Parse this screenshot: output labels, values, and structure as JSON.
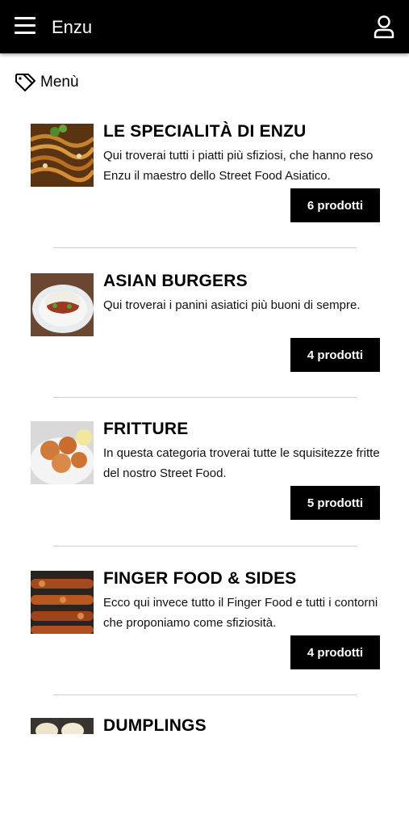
{
  "header": {
    "title": "Enzu",
    "menu_icon": "hamburger-menu-icon",
    "user_icon": "user-icon"
  },
  "section": {
    "icon": "tag-icon",
    "title": "Menù"
  },
  "categories": [
    {
      "title": "LE SPECIALITÀ DI ENZU",
      "description": "Qui troverai tutti i piatti più sfiziosi, che hanno reso Enzu il maestro dello Street Food Asiatico.",
      "count_label": "6 prodotti"
    },
    {
      "title": "ASIAN BURGERS",
      "description": "Qui troverai i panini asiatici più buoni di sempre.",
      "count_label": "4 prodotti"
    },
    {
      "title": "FRITTURE",
      "description": "In questa categoria troverai tutte le squisitezze fritte del nostro Street Food.",
      "count_label": "5 prodotti"
    },
    {
      "title": "FINGER FOOD & SIDES",
      "description": "Ecco qui invece tutto il Finger Food e tutti i contorni che proponiamo come sfiziosità.",
      "count_label": "4 prodotti"
    },
    {
      "title": "DUMPLINGS"
    }
  ],
  "colors": {
    "header_bg": "#000000",
    "button_bg": "#000000",
    "button_text": "#ffffff",
    "divider": "#cfcfcf"
  }
}
